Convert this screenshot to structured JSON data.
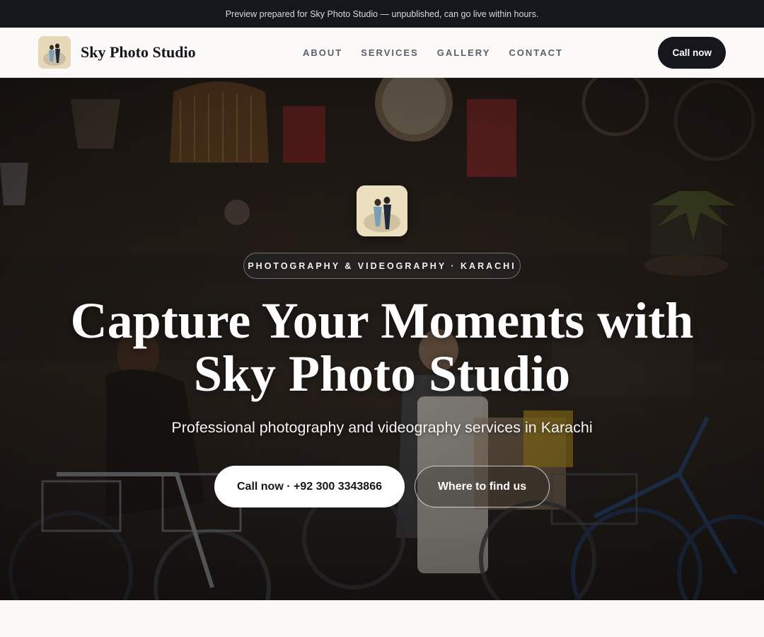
{
  "banner": {
    "text": "Preview prepared for Sky Photo Studio — unpublished, can go live within hours."
  },
  "header": {
    "brand_name": "Sky Photo Studio",
    "logo_icon": "couple-photo-logo",
    "nav": [
      "ABOUT",
      "SERVICES",
      "GALLERY",
      "CONTACT"
    ],
    "call_label": "Call now"
  },
  "hero": {
    "logo_icon": "couple-photo-logo",
    "tagline": "PHOTOGRAPHY & VIDEOGRAPHY · KARACHI",
    "headline_line1": "Capture Your Moments with",
    "headline_line2": "Sky Photo Studio",
    "subheadline": "Professional photography and videography services in Karachi",
    "primary_button": "Call now · +92 300 3343866",
    "secondary_button": "Where to find us",
    "background": "shop-with-bicycles-and-hanging-lanterns-photo"
  },
  "colors": {
    "dark": "#15171c",
    "page_bg": "#faf9f6",
    "nav_text": "#5a5f6a"
  }
}
